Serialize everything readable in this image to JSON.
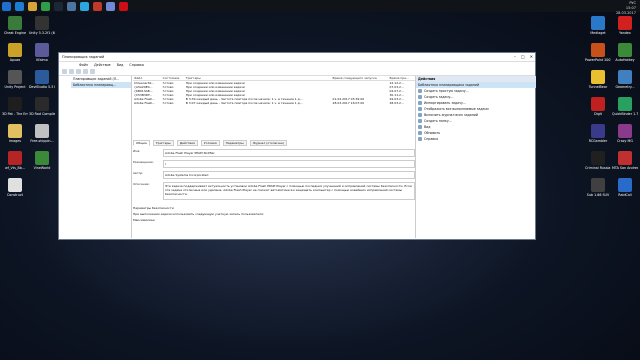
{
  "taskbar": {
    "icons": [
      {
        "name": "windows-icon",
        "color": "#1f6fd0"
      },
      {
        "name": "edge-icon",
        "color": "#1a7fd4"
      },
      {
        "name": "explorer-icon",
        "color": "#d6a53a"
      },
      {
        "name": "chrome-icon",
        "color": "#2e9e49"
      },
      {
        "name": "steam-icon",
        "color": "#1b2838"
      },
      {
        "name": "vk-icon",
        "color": "#4c75a3"
      },
      {
        "name": "telegram-icon",
        "color": "#2ca5e0"
      },
      {
        "name": "music-icon",
        "color": "#c0392b"
      },
      {
        "name": "discord-icon",
        "color": "#7289da"
      },
      {
        "name": "opera-icon",
        "color": "#cc0f16"
      }
    ],
    "tray_time": "15:07",
    "tray_date": "28.03.2017",
    "tray_lang": "РУС"
  },
  "desktop_icons_left": [
    {
      "label": "Cheat Engine",
      "color": "#3a7a3a"
    },
    {
      "label": "Unity 5.3.2f1 (64-bit)",
      "color": "#333"
    },
    {
      "label": "Архив",
      "color": "#c9a227"
    },
    {
      "label": "Kfalma",
      "color": "#5b5b9b"
    },
    {
      "label": "Unity Project",
      "color": "#555"
    },
    {
      "label": "DeviStudio 5.3 beta",
      "color": "#2b5b9b"
    },
    {
      "label": "3D Pat - The Empty Space",
      "color": "#1e1e1e"
    },
    {
      "label": "3D Rad Compiler",
      "color": "#2a2a2a"
    },
    {
      "label": "images",
      "color": "#e0c060"
    },
    {
      "label": "Free-shippin...",
      "color": "#c0c0c0"
    },
    {
      "label": "wf_Vts_Bb...",
      "color": "#b52525"
    },
    {
      "label": "VineWorld",
      "color": "#3a8a3a"
    },
    {
      "label": "Construct",
      "color": "#e0e0e0"
    }
  ],
  "desktop_icons_right": [
    {
      "label": "Yandex",
      "color": "#d02020"
    },
    {
      "label": "Mediaget",
      "color": "#2a78c8"
    },
    {
      "label": "AutoHotkey",
      "color": "#3a8a3a"
    },
    {
      "label": "PowerPoint 2007",
      "color": "#c8501a"
    },
    {
      "label": "Geometry...",
      "color": "#4080c0"
    },
    {
      "label": "TunnelBear",
      "color": "#e8c030"
    },
    {
      "label": "QuickBinder 1.7",
      "color": "#2aa060"
    },
    {
      "label": "Digit",
      "color": "#c02020"
    },
    {
      "label": "Crazy MG",
      "color": "#8a3a8a"
    },
    {
      "label": "RCGambler",
      "color": "#3a3a8a"
    },
    {
      "label": "MTA San Andreas 1.5",
      "color": "#c03030"
    },
    {
      "label": "Criminal Russia M",
      "color": "#202020"
    },
    {
      "label": "RaidCall",
      "color": "#2a6ac8"
    },
    {
      "label": "Sub 1.66 SUV",
      "color": "#404040"
    }
  ],
  "window": {
    "title": "Планировщик заданий",
    "menu": [
      "Файл",
      "Действие",
      "Вид",
      "Справка"
    ],
    "tree": [
      "Планировщик заданий (Л...",
      "Библиотека планировщ..."
    ],
    "columns": [
      "Файл",
      "Состояние",
      "Триггеры",
      "Время следующего запуска",
      "Время пре..."
    ],
    "rows": [
      [
        "CCleanerSk...",
        "Готово",
        "При создании или изменении задачи",
        "",
        "12.12.2..."
      ],
      [
        "{A5A29E0...",
        "Готово",
        "При создании или изменении задачи",
        "",
        "07.03.2..."
      ],
      [
        "{6B013AB...",
        "Готово",
        "При создании или изменении задачи",
        "",
        "04.07.2..."
      ],
      [
        "{C53B3DF...",
        "Готово",
        "При создании или изменении задачи",
        "",
        "30.11.2..."
      ],
      [
        "Adobe Flash...",
        "Готово",
        "В 3:39 каждый день - Частота повтора после начала: 1 ч. в течение 1 д...",
        "01.04.2017 03:39:00",
        "29.03.2..."
      ],
      [
        "Adobe Flash...",
        "Готово",
        "В 3:07 каждый день - Частота повтора после начала: 1 ч. в течение 1 д...",
        "28.03.2017 16:07:00",
        "28.03.2..."
      ]
    ],
    "tabs": [
      "Общие",
      "Триггеры",
      "Действия",
      "Условия",
      "Параметры",
      "Журнал (отключен)"
    ],
    "props": {
      "name_label": "Имя:",
      "name_value": "Adobe Flash Player PPAPI Notifier",
      "location_label": "Размещение:",
      "location_value": "\\",
      "author_label": "Автор:",
      "author_value": "Adobe Systems Incorporated",
      "desc_label": "Описание:",
      "desc_value": "Эта задача поддерживает актуальность установки Adobe Flash PPAPI Player с помощью последних улучшений и исправлений системы безопасности. Если эта задача отключена или удалена, Adobe Flash Player не сможет автоматически защищать компьютер с помощью новейших исправлений системы безопасности.",
      "security_header": "Параметры безопасности",
      "security_text": "При выполнении задачи использовать следующую учетную запись пользователя:",
      "security_user": "Максимилиан"
    },
    "actions_header": "Действия",
    "actions_section": "Библиотека планировщика заданий",
    "actions": [
      "Создать простую задачу...",
      "Создать задачу...",
      "Импортировать задачу...",
      "Отображать все выполняемые задачи",
      "Включить журнал всех заданий",
      "Создать папку...",
      "Вид",
      "Обновить",
      "Справка"
    ]
  }
}
